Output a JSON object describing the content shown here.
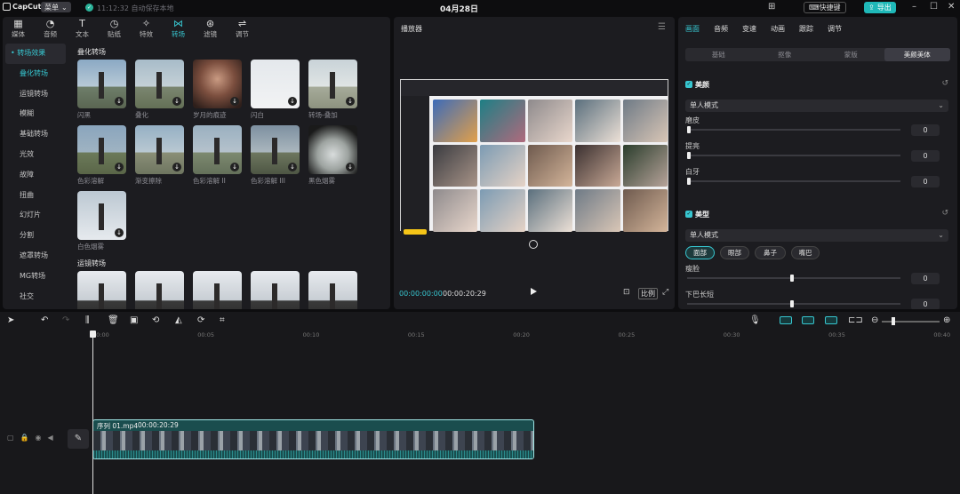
{
  "app": {
    "logo": "CapCut",
    "menu": "菜单",
    "autosave": "11:12:32 自动保存本地",
    "project_date": "04月28日",
    "shortcut_label": "快捷键",
    "export_label": "导出"
  },
  "media_tabs": [
    {
      "icon": "▦",
      "label": "媒体"
    },
    {
      "icon": "◔",
      "label": "音频"
    },
    {
      "icon": "T",
      "label": "文本"
    },
    {
      "icon": "◷",
      "label": "贴纸"
    },
    {
      "icon": "✧",
      "label": "特效"
    },
    {
      "icon": "⋈",
      "label": "转场"
    },
    {
      "icon": "⊛",
      "label": "滤镜"
    },
    {
      "icon": "⇌",
      "label": "调节"
    }
  ],
  "categories": [
    "• 转场效果",
    "叠化转场",
    "运镜转场",
    "模糊",
    "基础转场",
    "光效",
    "故障",
    "扭曲",
    "幻灯片",
    "分割",
    "遮罩转场",
    "MG转场",
    "社交"
  ],
  "section1_title": "叠化转场",
  "transitions": [
    {
      "label": "闪黑"
    },
    {
      "label": "叠化"
    },
    {
      "label": "岁月的痕迹"
    },
    {
      "label": "闪白"
    },
    {
      "label": "转场-叠加"
    },
    {
      "label": "色彩溶解"
    },
    {
      "label": "渐变擦除"
    },
    {
      "label": "色彩溶解 II"
    },
    {
      "label": "色彩溶解 III"
    },
    {
      "label": "黑色烟雾"
    },
    {
      "label": "白色烟雾"
    }
  ],
  "section2_title": "运镜转场",
  "player": {
    "title": "播放器",
    "time_current": "00:00:00:00",
    "time_total": "00:00:20:29",
    "ratio_label": "比例"
  },
  "props": {
    "tabs": [
      "画面",
      "音频",
      "变速",
      "动画",
      "跟踪",
      "调节"
    ],
    "segments": [
      "基础",
      "抠像",
      "蒙版",
      "美颜美体"
    ],
    "beauty_label": "美颜",
    "beauty_mode": "单人模式",
    "sliders1": [
      {
        "label": "磨皮",
        "value": "0"
      },
      {
        "label": "提亮",
        "value": "0"
      },
      {
        "label": "白牙",
        "value": "0"
      }
    ],
    "shape_label": "美型",
    "shape_mode": "单人模式",
    "parts": [
      "面部",
      "眼部",
      "鼻子",
      "嘴巴"
    ],
    "sliders2": [
      {
        "label": "瘦脸",
        "value": "0"
      },
      {
        "label": "下巴长短",
        "value": "0"
      }
    ]
  },
  "timeline": {
    "ticks": [
      "00:00",
      "00:05",
      "00:10",
      "00:15",
      "00:20",
      "00:25",
      "00:30",
      "00:35",
      "00:40"
    ],
    "clip_name": "序列 01.mp4",
    "clip_duration": "00:00:20:29"
  },
  "colors": {
    "accent": "#37c6d0",
    "export": "#1fb8b8",
    "clip": "#1a4d4e"
  }
}
